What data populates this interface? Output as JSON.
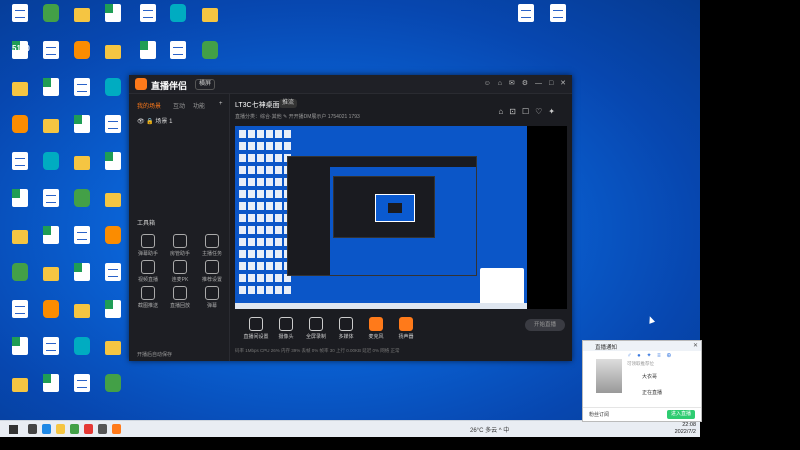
{
  "colors": {
    "accent": "#ff7a1a",
    "desktop": "#0a63d6",
    "app_bg": "#1b1c21",
    "enter_btn": "#2ecc71"
  },
  "desktop": {
    "watermark": "5140"
  },
  "obs": {
    "app_title": "直播伴侣",
    "mode": "横屏",
    "window_buttons": [
      "☺",
      "⌂",
      "✉",
      "⚙",
      "—",
      "□",
      "✕"
    ],
    "tabs": [
      "我的场景",
      "互动",
      "功能",
      "+"
    ],
    "scene": "场景 1",
    "tools_title": "工具箱",
    "tools": [
      "弹幕助手",
      "房管助手",
      "主播任务",
      "视频直播",
      "连麦PK",
      "推荐设置",
      "截图推送",
      "直播回放",
      "弹幕"
    ],
    "bottom_tip": "开播后自动保存",
    "room_title": "LT3C七神桌面",
    "live_badge": "推流",
    "room_info": "直播分类：综合·其他 ✎   开开播DM展示户   1754021   1793",
    "room_tools": [
      "⌂",
      "⊡",
      "☐",
      "♡",
      "✦"
    ],
    "controls": [
      "直播间设置",
      "摄像头",
      "全屏录制",
      "多媒体",
      "麦克风",
      "扬声器"
    ],
    "start_live": "开始直播",
    "stats": "码率 1Mbps   CPU 26%   内存 39%   丢帧 0%   帧率 30   上行 0.00KB   延迟 0%   网络 正常"
  },
  "taskbar": {
    "tray": "26°C  多云  ^  中  ",
    "time": "22:08",
    "date": "2022/7/2"
  },
  "popup": {
    "title": "直播通知",
    "close": "✕",
    "toolbar": "♂ ● ✦ ≡ ⊕",
    "subtitle": "可领取推荐位",
    "name": "大衣哥",
    "status": "正在直播",
    "footer_label": "粉丝订阅",
    "enter": "进入直播"
  }
}
